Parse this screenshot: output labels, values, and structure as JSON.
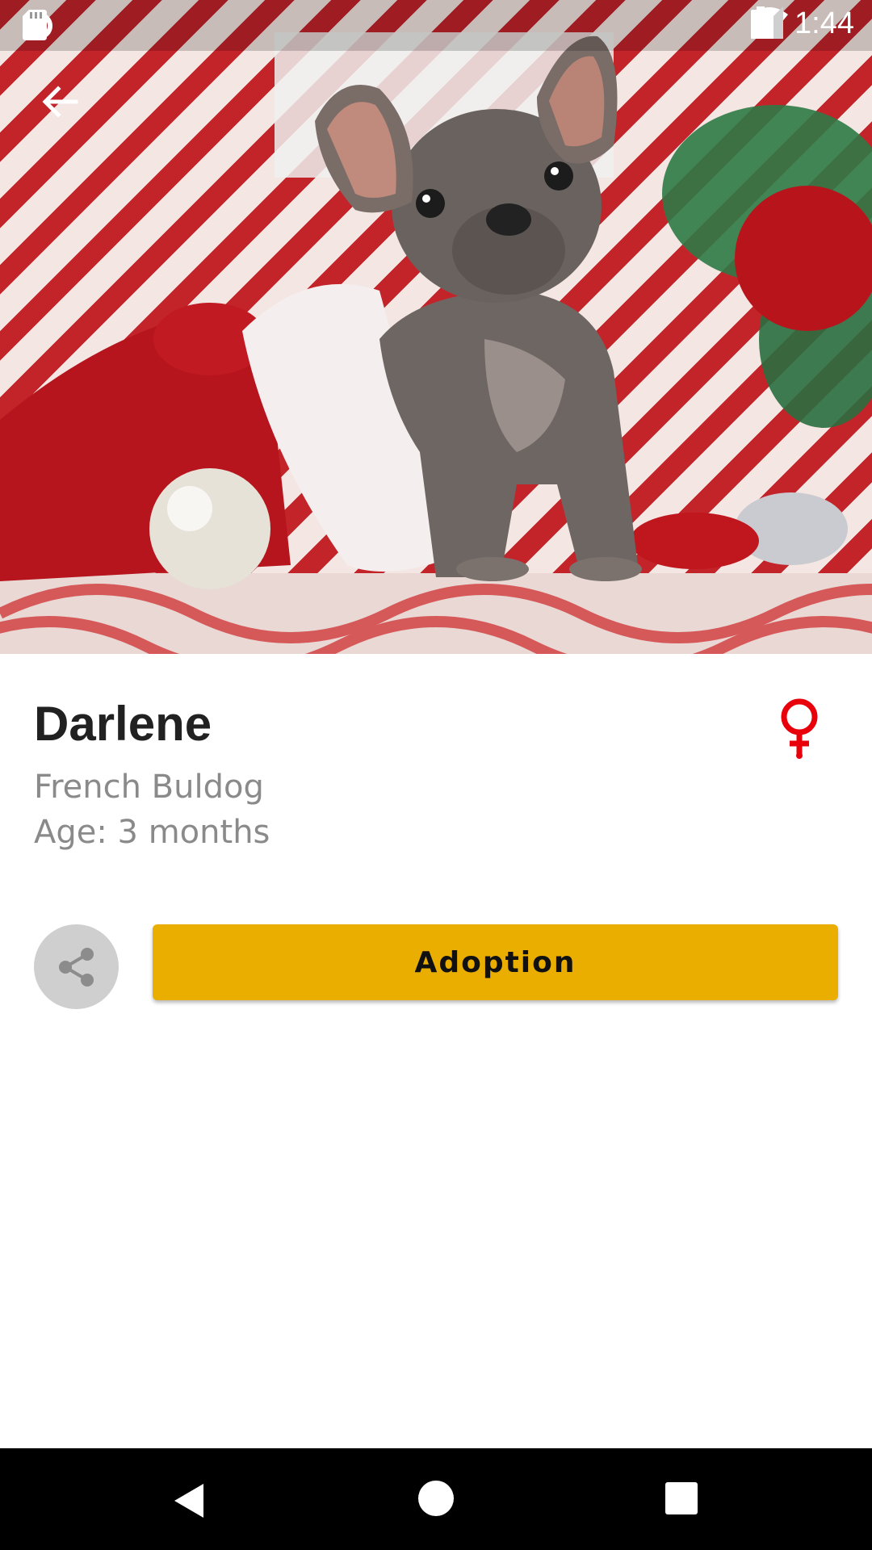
{
  "status_bar": {
    "time": "1:44",
    "left_icons": [
      "notification-ring-icon",
      "sd-card-icon"
    ],
    "right_icons": [
      "wifi-icon",
      "signal-icon",
      "battery-icon"
    ]
  },
  "toolbar": {
    "back_icon": "arrow-left-icon"
  },
  "hero": {
    "image": "french-bulldog-puppy-christmas-photo"
  },
  "pet": {
    "name": "Darlene",
    "breed": "French Buldog",
    "age": "Age: 3 months",
    "gender_icon": "female-symbol-icon"
  },
  "actions": {
    "share_icon": "share-icon",
    "adopt_label": "Adoption"
  },
  "nav_bar": {
    "icons": [
      "nav-back-icon",
      "nav-home-icon",
      "nav-recents-icon"
    ]
  },
  "colors": {
    "accent": "#EAAE00",
    "gender": "#E8000B",
    "share_bg": "#CFCFCF",
    "secondary_text": "#8A8A8A"
  }
}
